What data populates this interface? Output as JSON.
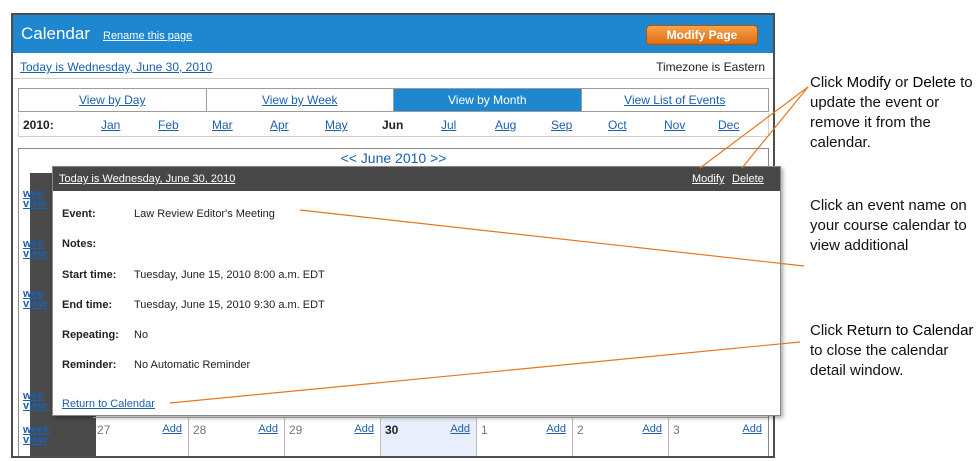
{
  "header": {
    "title": "Calendar",
    "rename_label": "Rename this page",
    "modify_button": "Modify Page"
  },
  "info": {
    "today": "Today is Wednesday, June 30, 2010",
    "timezone": "Timezone is Eastern"
  },
  "tabs": [
    "View by Day",
    "View by Week",
    "View by Month",
    "View List of Events"
  ],
  "active_tab": "View by Month",
  "months": {
    "year": "2010:",
    "items": [
      "Jan",
      "Feb",
      "Mar",
      "Apr",
      "May",
      "Jun",
      "Jul",
      "Aug",
      "Sep",
      "Oct",
      "Nov",
      "Dec"
    ],
    "current": "Jun"
  },
  "calendar": {
    "nav": "<< June 2010 >>",
    "week_label_line1": "wee",
    "week_label_line2": "view",
    "week_link_full_1": "week",
    "week_link_full_2": "view",
    "last_row_days": [
      "27",
      "28",
      "29",
      "30",
      "1",
      "2",
      "3"
    ],
    "add_label": "Add"
  },
  "popup": {
    "date": "Today is Wednesday, June 30, 2010",
    "modify": "Modify",
    "delete": "Delete",
    "fields": [
      {
        "label": "Event:",
        "value": "Law Review Editor's Meeting"
      },
      {
        "label": "Notes:",
        "value": ""
      },
      {
        "label": "Start time:",
        "value": "Tuesday, June 15, 2010 8:00 a.m. EDT"
      },
      {
        "label": "End time:",
        "value": "Tuesday, June 15, 2010 9:30 a.m. EDT"
      },
      {
        "label": "Repeating:",
        "value": "No"
      },
      {
        "label": "Reminder:",
        "value": "No Automatic Reminder"
      }
    ],
    "return_link": "Return to Calendar"
  },
  "callouts": {
    "c1": {
      "pre": "Click ",
      "b1": "Modify",
      "mid": " or ",
      "b2": "Delete",
      "post": " to update the event or remove it from the calendar."
    },
    "c2": {
      "text": "Click an event name on your course calendar to view additional"
    },
    "c3": {
      "pre": "Click ",
      "b1": "Return to Calendar",
      "post": " to close the calendar detail window."
    }
  },
  "colors": {
    "header_blue": "#1f87cf",
    "button_orange": "#e06d12",
    "popup_header": "#474747",
    "callout_line": "#e8761e",
    "link": "#1a5fb0"
  }
}
